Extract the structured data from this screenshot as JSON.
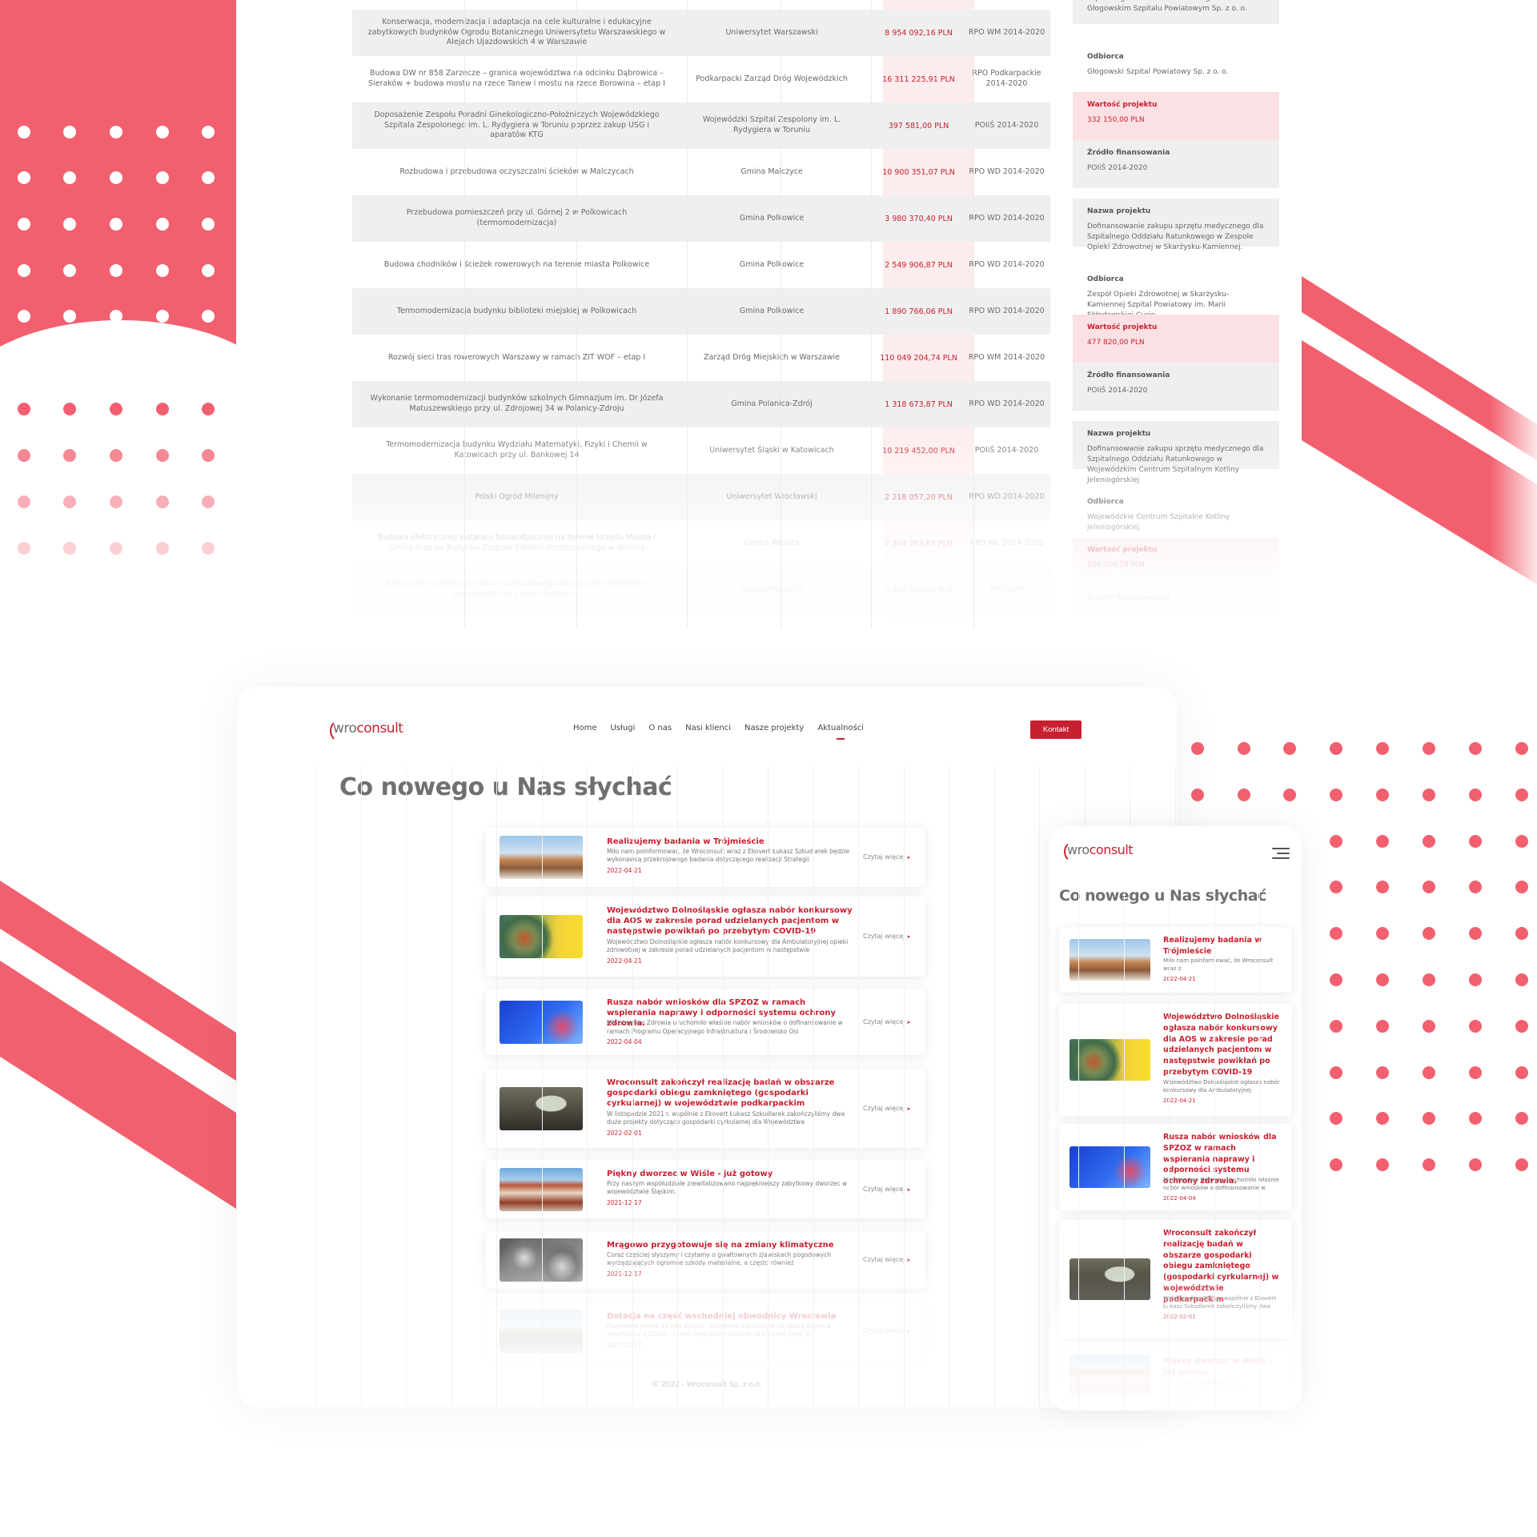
{
  "table": {
    "rows": [
      {
        "name": "Konserwacja, modernizacja i adaptacja na cele kulturalne i edukacyjne zabytkowych budynków Ogrodu Botanicznego Uniwersytetu Warszawskiego w Alejach Ujazdowskich 4 w Warszawie",
        "recipient": "Uniwersytet Warszawski",
        "value": "8 954 092,16 PLN",
        "source": "RPO WM 2014-2020"
      },
      {
        "name": "Budowa DW nr 858 Zarzecze – granica województwa na odcinku Dąbrowica – Sieraków + budowa mostu na rzece Tanew i mostu na rzece Borowina – etap I",
        "recipient": "Podkarpacki Zarząd Dróg Wojewódzkich",
        "value": "16 311 225,91 PLN",
        "source": "RPO Podkarpackie 2014-2020"
      },
      {
        "name": "Doposażenie Zespołu Poradni Ginekologiczno-Położniczych Wojewódzkiego Szpitala Zespolonego im. L. Rydygiera w Toruniu poprzez zakup USG i aparatów KTG",
        "recipient": "Wojewódzki Szpital Zespolony im. L. Rydygiera w Toruniu",
        "value": "397 581,00 PLN",
        "source": "POIiŚ 2014-2020"
      },
      {
        "name": "Rozbudowa i przebudowa oczyszczalni ścieków w Malczycach",
        "recipient": "Gmina Malczyce",
        "value": "10 900 351,07 PLN",
        "source": "RPO WD 2014-2020"
      },
      {
        "name": "Przebudowa pomieszczeń przy ul. Górnej 2 w Polkowicach (termomodernizacja)",
        "recipient": "Gmina Polkowice",
        "value": "3 980 370,40 PLN",
        "source": "RPO WD 2014-2020"
      },
      {
        "name": "Budowa chodników i ścieżek rowerowych na terenie miasta Polkowice",
        "recipient": "Gmina Polkowice",
        "value": "2 549 906,87 PLN",
        "source": "RPO WD 2014-2020"
      },
      {
        "name": "Termomodernizacja budynku biblioteki miejskiej w Polkowicach",
        "recipient": "Gmina Polkowice",
        "value": "1 890 766,06 PLN",
        "source": "RPO WD 2014-2020"
      },
      {
        "name": "Rozwój sieci tras rowerowych Warszawy w ramach ZIT WOF – etap I",
        "recipient": "Zarząd Dróg Miejskich w Warszawie",
        "value": "110 049 204,74 PLN",
        "source": "RPO WM 2014-2020"
      },
      {
        "name": "Wykonanie termomodernizacji budynków szkolnych Gimnazjum im. Dr Józefa Matuszewskiego przy ul. Zdrojowej 34 w Polanicy-Zdroju",
        "recipient": "Gmina Polanica-Zdrój",
        "value": "1 318 673,87 PLN",
        "source": "RPO WD 2014-2020"
      },
      {
        "name": "Termomodernizacja budynku Wydziału Matematyki, Fizyki i Chemii w Katowicach przy ul. Bankowej 14",
        "recipient": "Uniwersytet Śląski w Katowicach",
        "value": "10 219 452,00 PLN",
        "source": "POIiŚ 2014-2020"
      },
      {
        "name": "Polski Ogród Milenijny",
        "recipient": "Uniwersytet Wrocławski",
        "value": "2 218 057,20 PLN",
        "source": "RPO WD 2014-2020"
      },
      {
        "name": "Budowa elektrycznej instalacji fotowoltaicznej na terenie Urzędu Miasta i Gminy oraz na Budynku Zespołu Szkolno-Przedszkolnego w Witnicy",
        "recipient": "Gmina Witnica",
        "value": "2 304 263,65 PLN",
        "source": "RPO WL 2014-2020"
      },
      {
        "name": "Zakup bez emisyjnego taboru autobusowego do połączeń miejskich i podmiejskich w gminie Polkowice",
        "recipient": "Gmina Polkowice",
        "value": "3 405 370,50 PLN",
        "source": "RPOSKW"
      }
    ]
  },
  "side": {
    "label_project": "Nazwa projektu",
    "label_recipient": "Odbiorca",
    "label_value": "Wartość projektu",
    "label_source": "Źródło finansowania",
    "items": [
      {
        "project": "Dofinansowanie zakupu sprzętu medycznego dla Szpitalnego Oddziału Ratunkowego w Głogowskim Szpitalu Powiatowym Sp. z o. o.",
        "recipient": "Głogowski Szpital Powiatowy Sp. z o. o.",
        "value": "332 150,00 PLN",
        "source": "POIiŚ 2014-2020"
      },
      {
        "project": "Dofinansowanie zakupu sprzętu medycznego dla Szpitalnego Oddziału Ratunkowego w Zespole Opieki Zdrowotnej w Skarżysku-Kamiennej.",
        "recipient": "Zespół Opieki Zdrowotnej w Skarżysku-Kamiennej Szpital Powiatowy im. Marii Skłodowskiej-Curie",
        "value": "477 820,00 PLN",
        "source": "POIiŚ 2014-2020"
      },
      {
        "project": "Dofinansowanie zakupu sprzętu medycznego dla Szpitalnego Oddziału Ratunkowego w Wojewódzkim Centrum Szpitalnym Kotliny Jeleniogórskiej",
        "recipient": "Wojewódzkie Centrum Szpitalne Kotliny Jeleniogórskiej",
        "value": "266 760,78 PLN",
        "source": ""
      }
    ]
  },
  "logo": {
    "wro": "wro",
    "consult": "consult"
  },
  "nav": {
    "items": [
      "Home",
      "Usługi",
      "O nas",
      "Nasi klienci",
      "Nasze projekty",
      "Aktualności"
    ],
    "contact": "Kontakt"
  },
  "page_title": "Co nowego u Nas słychać",
  "read_more": "Czytaj więcej",
  "footer": "© 2022 - Wroconsult Sp. z o.o.",
  "news": [
    {
      "title": "Realizujemy badania w Trójmieście",
      "desc": "Miło nam poinformować, że Wroconsult wraz z Ekovert Łukasz Szkudlarek będzie wykonawcą przekrojowego badania dotyczącego realizacji Strategii",
      "mdesc": "Miło nam poinformować, że Wroconsult wraz z",
      "date": "2022-04-21",
      "thumb": "city"
    },
    {
      "title": "Województwo Dolnośląskie ogłasza nabór konkursowy dla AOS w zakresie porad udzielanych pacjentom w następstwie powikłań po przebytym COVID-19",
      "desc": "Województwo Dolnośląskie ogłasza nabór konkursowy dla Ambulatoryjnej opieki zdrowotnej w zakresie porad udzielanych pacjentom w następstwie",
      "mdesc": "Województwo Dolnośląskie ogłasza nabór konkursowy dla Ambulatoryjnej",
      "date": "2022-04-21",
      "thumb": "covid"
    },
    {
      "title": "Rusza nabór wniosków dla SPZOZ w ramach wspierania naprawy i odporności systemu ochrony zdrowia.",
      "desc": "Ministerstwo Zdrowia uruchomiło właśnie nabór wniosków o dofinansowanie w ramach Programu Operacyjnego Infrastruktura i Środowisko Osi",
      "mdesc": "Ministerstwo Zdrowia uruchomiło właśnie nabór wniosków o dofinansowanie w ramach",
      "date": "2022-04-04",
      "thumb": "blue"
    },
    {
      "title": "Wroconsult zakończył realizację badań w obszarze gospodarki obiegu zamkniętego (gospodarki cyrkularnej) w województwie podkarpackim",
      "desc": "W listopadzie 2021 r. wspólnie z Ekovert Łukasz Szkudlarek zakończyliśmy dwa duże projekty dotyczące gospodarki cyrkularnej dla Województwa",
      "mdesc": "W listopadzie 2021 r. wspólnie z Ekovert Łukasz Szkudlarek zakończyliśmy dwa",
      "date": "2022-02-01",
      "thumb": "conf"
    },
    {
      "title": "Piękny dworzec w Wiśle - już gotowy",
      "desc": "Przy naszym współudziale zrewitalizowano najpiękniejszy zabytkowy dworzec w województwie Śląskim.",
      "mdesc": "Przy naszym współudziale zrewitalizowano najpiękniejszy",
      "date": "2021-12-17",
      "thumb": "station"
    },
    {
      "title": "Mrągowo przygotowuje się na zmiany klimatyczne",
      "desc": "Coraz częściej słyszymy i czytamy o gwałtownych zjawiskach pogodowych wyrządzających ogromne szkody materialne, a często również",
      "date": "2021-12-17",
      "thumb": "pipes"
    },
    {
      "title": "Dotacja na część wschodniej obwodnicy Wrocławia",
      "desc": "Pozyskane ponad 45 mln dotacji - sukcesem zakończyła się nasza ostatnia współpraca z DSDiK - środki będą przeznaczone na budowę drogi w",
      "date": "2021-12-17",
      "thumb": "road"
    }
  ],
  "colors": {
    "accent": "#c8202f",
    "brand_pink": "#f2606f"
  }
}
